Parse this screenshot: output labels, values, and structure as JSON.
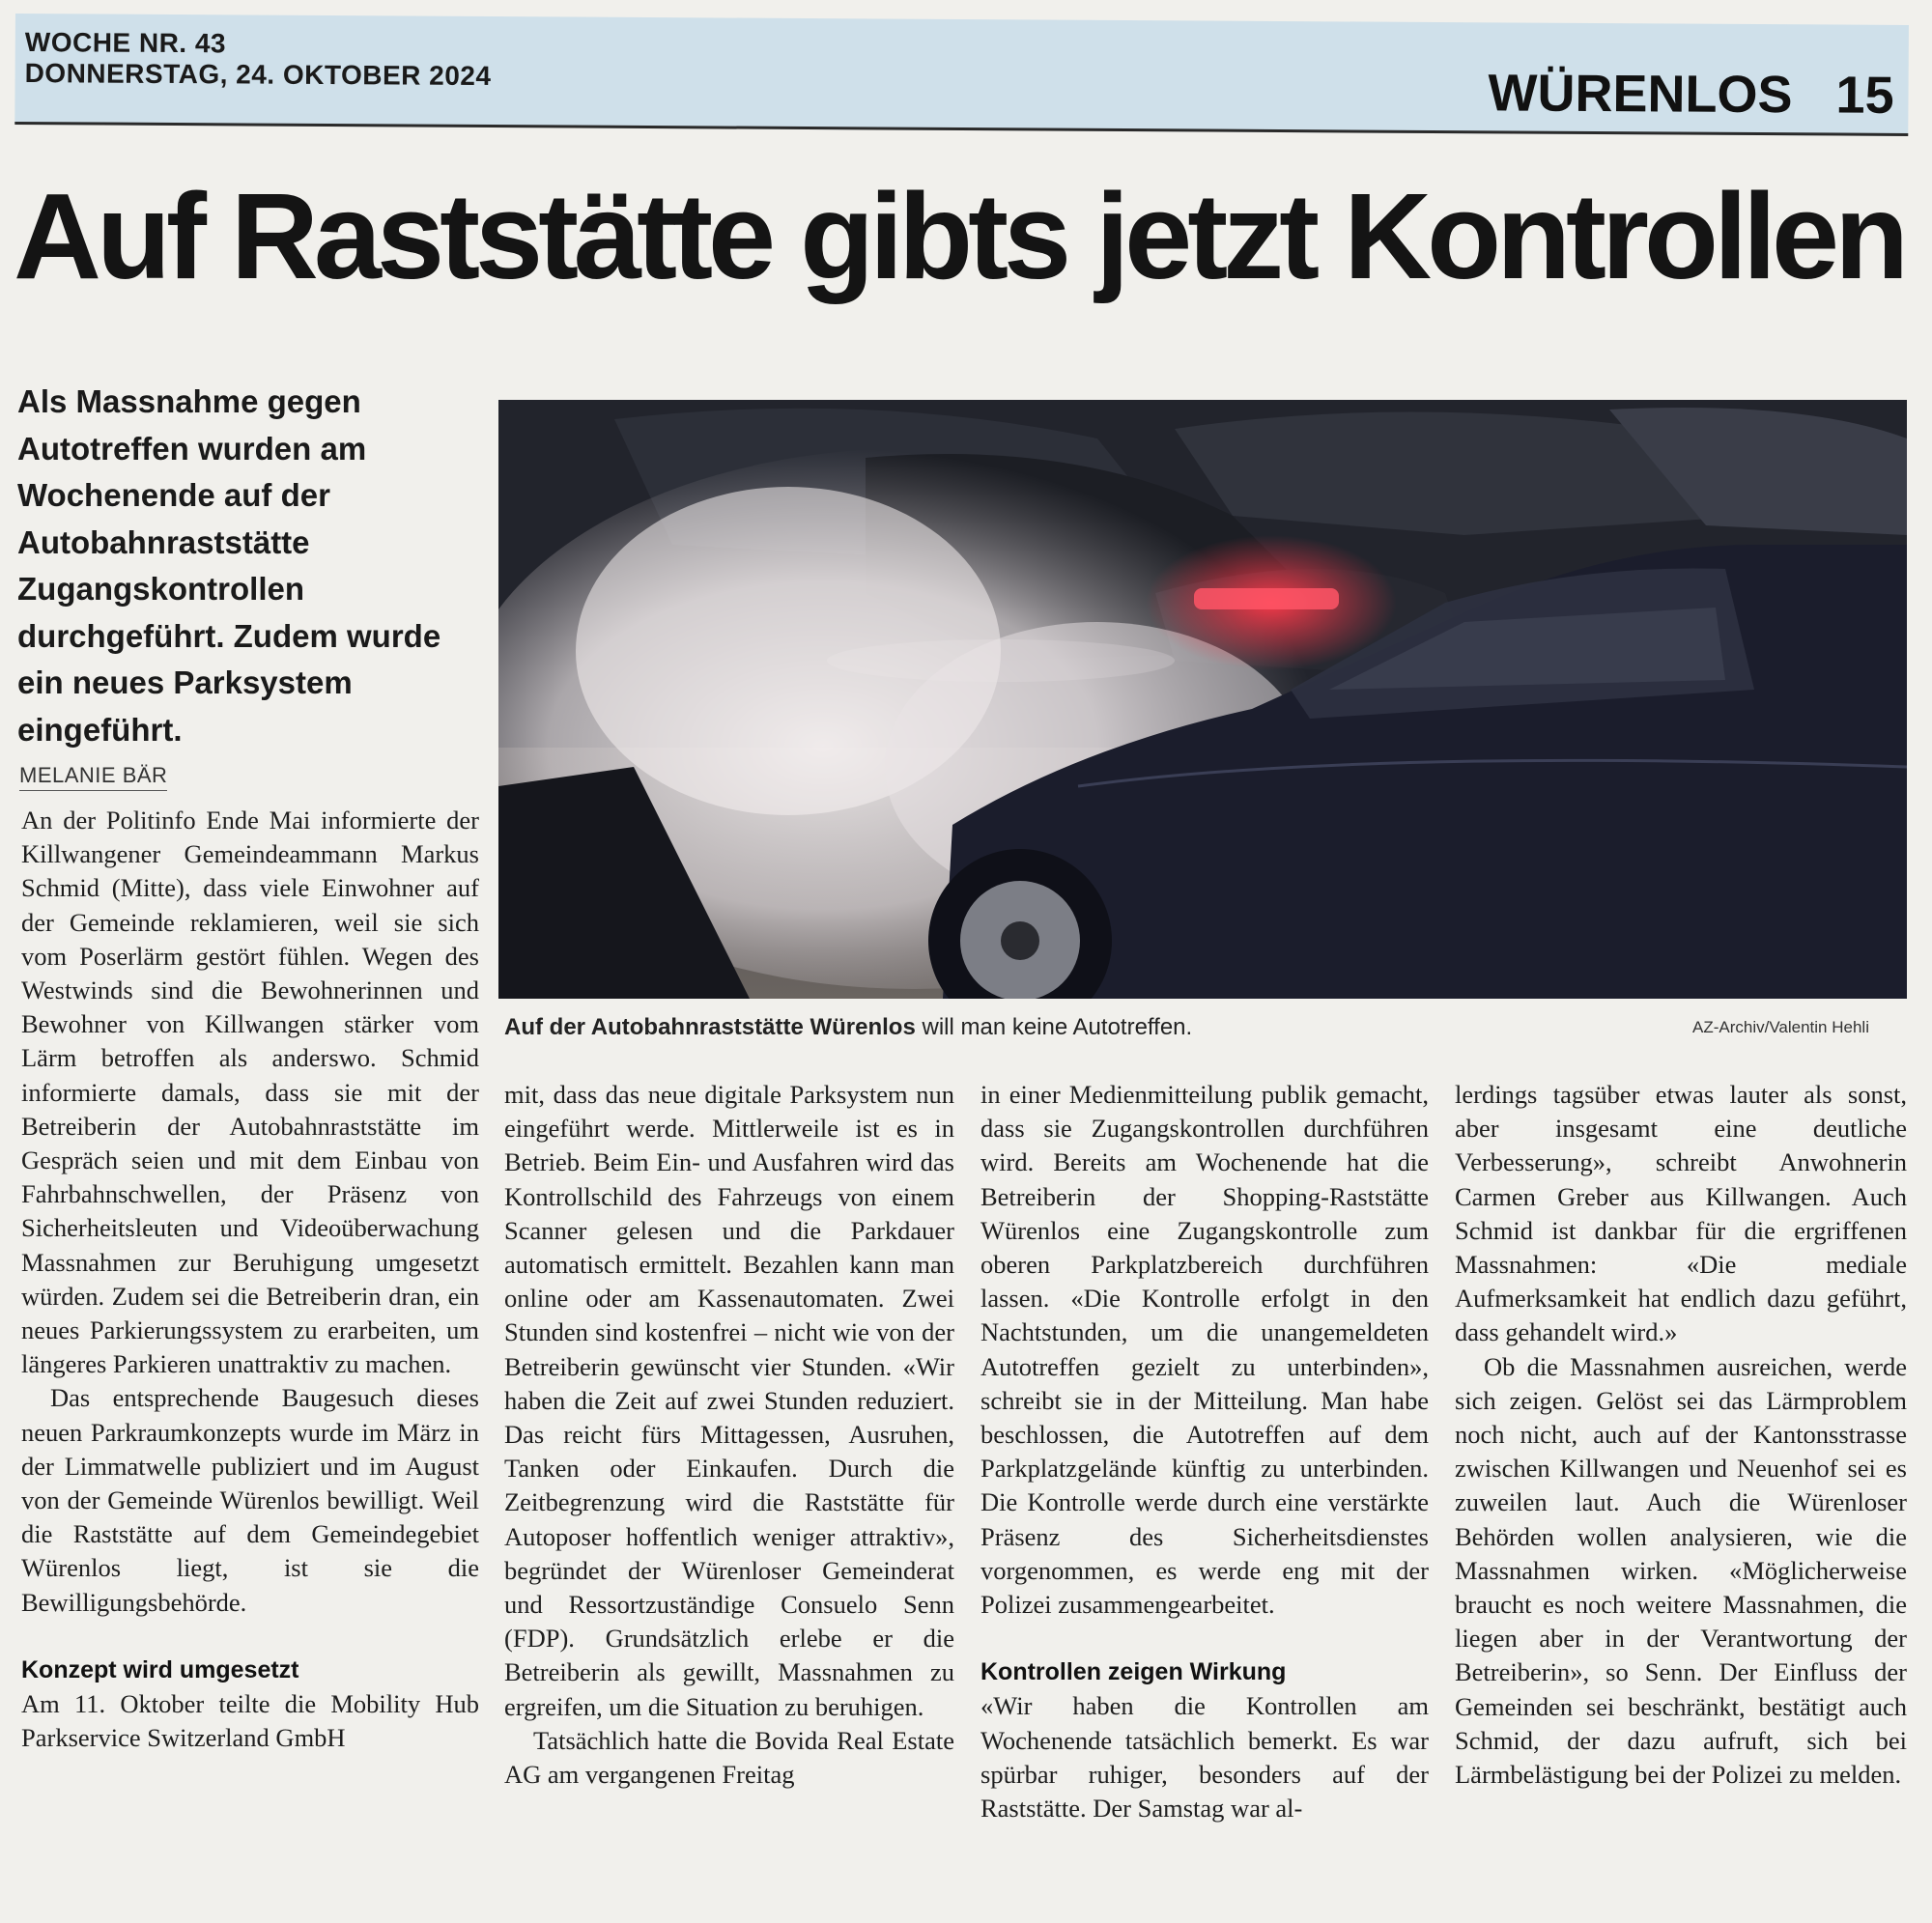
{
  "header": {
    "week": "WOCHE NR. 43",
    "date": "DONNERSTAG, 24. OKTOBER 2024",
    "section": "WÜRENLOS",
    "page": "15"
  },
  "headline": "Auf Raststätte gibts jetzt Kontrollen",
  "lead": "Als Massnahme gegen Autotreffen wurden am Wochenende auf der Autobahnraststätte Zugangskontrollen durchgeführt. Zudem wurde ein neues Parksystem eingeführt.",
  "author": "MELANIE BÄR",
  "photo": {
    "caption_bold": "Auf der Autobahnraststätte Würenlos",
    "caption_rest": " will man keine Autotreffen.",
    "credit": "AZ-Archiv/Valentin Hehli"
  },
  "article": {
    "col1": {
      "p1": "An der Politinfo Ende Mai informierte der Killwangener Gemeindeammann Markus Schmid (Mitte), dass viele Einwohner auf der Gemeinde reklamieren, weil sie sich vom Poserlärm gestört fühlen. Wegen des Westwinds sind die Bewohnerinnen und Bewohner von Killwangen stärker vom Lärm betroffen als anderswo. Schmid informierte damals, dass sie mit der Betreiberin der Autobahnraststätte im Gespräch seien und mit dem Einbau von Fahrbahnschwellen, der Präsenz von Sicherheitsleuten und Videoüberwachung Massnahmen zur Beruhigung umgesetzt würden. Zudem sei die Betreiberin dran, ein neues Parkierungssystem zu erarbeiten, um längeres Parkieren unattraktiv zu machen.",
      "p2": "Das entsprechende Baugesuch dieses neuen Parkraumkonzepts wurde im März in der Limmatwelle publiziert und im August von der Gemeinde Würenlos bewilligt. Weil die Raststätte auf dem Gemeindegebiet Würenlos liegt, ist sie die Bewilligungsbehörde.",
      "heading": "Konzept wird umgesetzt",
      "p3": "Am 11. Oktober teilte die Mobility Hub Parkservice Switzerland GmbH"
    },
    "col2": {
      "p1": "mit, dass das neue digitale Parksystem nun eingeführt werde. Mittlerweile ist es in Betrieb. Beim Ein- und Ausfahren wird das Kontrollschild des Fahrzeugs von einem Scanner gelesen und die Parkdauer automatisch ermittelt. Bezahlen kann man online oder am Kassenautomaten. Zwei Stunden sind kostenfrei – nicht wie von der Betreiberin gewünscht vier Stunden. «Wir haben die Zeit auf zwei Stunden reduziert. Das reicht fürs Mittagessen, Ausruhen, Tanken oder Einkaufen. Durch die Zeitbegrenzung wird die Raststätte für Autoposer hoffentlich weniger attraktiv», begründet der Würenloser Gemeinderat und Ressortzuständige Consuelo Senn (FDP). Grundsätzlich erlebe er die Betreiberin als gewillt, Massnahmen zu ergreifen, um die Situation zu beruhigen.",
      "p2": "Tatsächlich hatte die Bovida Real Estate AG am vergangenen Freitag"
    },
    "col3": {
      "p1": "in einer Medienmitteilung publik gemacht, dass sie Zugangskontrollen durchführen wird. Bereits am Wochenende hat die Betreiberin der Shopping-Raststätte Würenlos eine Zugangskontrolle zum oberen Parkplatzbereich durchführen lassen. «Die Kontrolle erfolgt in den Nachtstunden, um die unangemeldeten Autotreffen gezielt zu unterbinden», schreibt sie in der Mitteilung. Man habe beschlossen, die Autotreffen auf dem Parkplatzgelände künftig zu unterbinden. Die Kontrolle werde durch eine verstärkte Präsenz des Sicherheitsdienstes vorgenommen, es werde eng mit der Polizei zusammengearbeitet.",
      "heading": "Kontrollen zeigen Wirkung",
      "p2": "«Wir haben die Kontrollen am Wochenende tatsächlich bemerkt. Es war spürbar ruhiger, besonders auf der Raststätte. Der Samstag war al-"
    },
    "col4": {
      "p1": "lerdings tagsüber etwas lauter als sonst, aber insgesamt eine deutliche Verbesserung», schreibt Anwohnerin Carmen Greber aus Killwangen. Auch Schmid ist dankbar für die ergriffenen Massnahmen: «Die mediale Aufmerksamkeit hat endlich dazu geführt, dass gehandelt wird.»",
      "p2": "Ob die Massnahmen ausreichen, werde sich zeigen. Gelöst sei das Lärmproblem noch nicht, auch auf der Kantonsstrasse zwischen Killwangen und Neuenhof sei es zuweilen laut. Auch die Würenloser Behörden wollen analysieren, wie die Massnahmen wirken. «Möglicherweise braucht es noch weitere Massnahmen, die liegen aber in der Verantwortung der Betreiberin», so Senn. Der Einfluss der Gemeinden sei beschränkt, bestätigt auch Schmid, der dazu aufruft, sich bei Lärmbelästigung bei der Polizei zu melden."
    }
  }
}
